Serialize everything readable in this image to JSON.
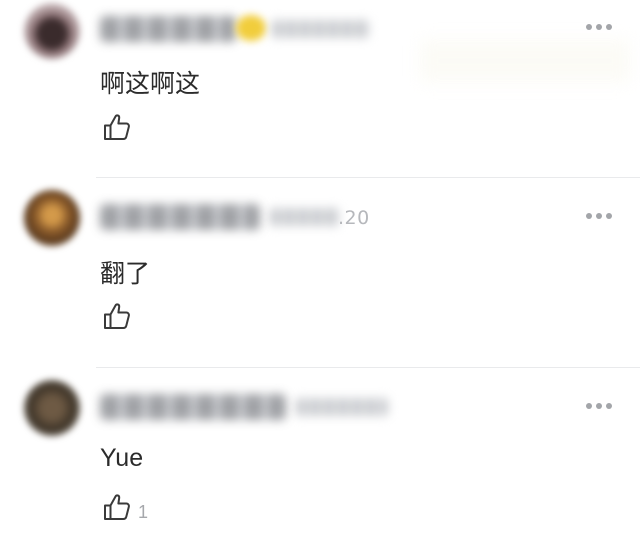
{
  "comments": [
    {
      "text": "啊这啊这",
      "time_visible": "",
      "like_count": ""
    },
    {
      "text": "翻了",
      "time_visible": ".20",
      "like_count": ""
    },
    {
      "text": "Yue",
      "time_visible": "",
      "like_count": "1"
    }
  ],
  "icons": {
    "like": "thumbs-up-outline",
    "more": "three-dots-horizontal"
  },
  "colors": {
    "text": "#2b2b2b",
    "meta": "#a6a8ac",
    "divider": "#e9eaec",
    "badge": "#f1cd3c"
  }
}
